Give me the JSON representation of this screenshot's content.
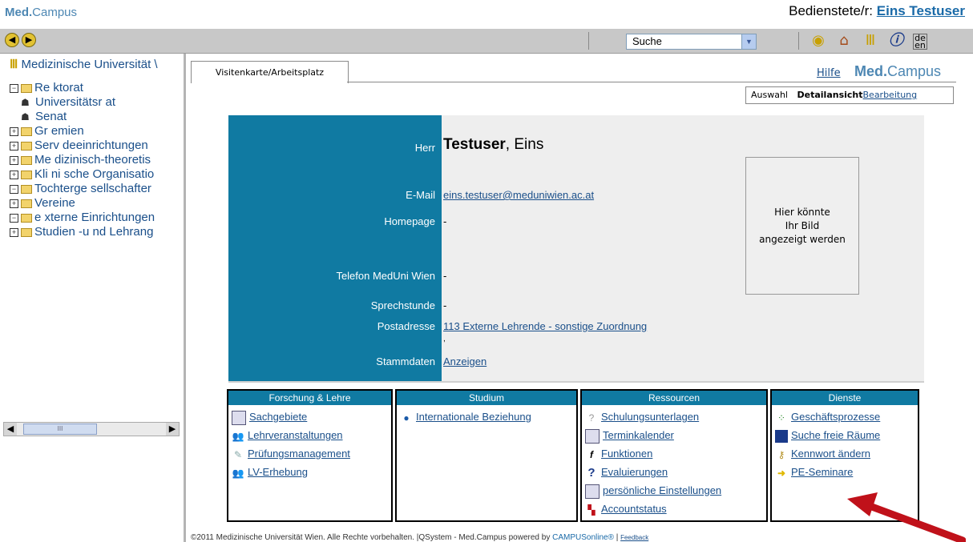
{
  "brand": {
    "med": "Med",
    "campus": "Campus",
    "dot": "."
  },
  "user": {
    "prefix": "Bedienstete/r:",
    "name": "Eins Testuser"
  },
  "toolbar": {
    "search_value": "Suche"
  },
  "leftnav": {
    "root": "Medizinische Universität \\",
    "items": [
      "Re ktorat",
      "Universitätsr at",
      "Senat",
      "Gr emien",
      "Serv deeinrichtungen",
      "Me dizinisch-theoretis",
      "Kli ni sche Organisatio",
      "Tochterge sellschafter",
      "Vereine",
      "e xterne Einrichtungen",
      "Studien -u nd Lehrang"
    ],
    "scroll_thumb": "III"
  },
  "tabs": {
    "active": "Visitenkarte/Arbeitsplatz"
  },
  "help": "Hilfe",
  "subnav": {
    "a": "Auswahl",
    "b": "Detailansicht",
    "c": "Bearbeitung"
  },
  "profile": {
    "salutation": "Herr",
    "lastname": "Testuser",
    "firstname": ", Eins",
    "email_label": "E-Mail",
    "email": "eins.testuser@meduniwien.ac.at",
    "homepage_label": "Homepage",
    "homepage": "-",
    "phone_label": "Telefon  MedUni Wien",
    "phone": "-",
    "office_label": "Sprechstunde",
    "office": "-",
    "address_label": "Postadresse",
    "address": "113 Externe Lehrende - sonstige Zuordnung",
    "comma": ",",
    "master_label": "Stammdaten",
    "master": "Anzeigen",
    "photo_l1": "Hier könnte",
    "photo_l2": "Ihr Bild",
    "photo_l3": "angezeigt werden"
  },
  "boxes": {
    "forschung": {
      "title": "Forschung & Lehre",
      "items": [
        "Sachgebiete",
        "Lehrveranstaltungen",
        "Prüfungsmanagement",
        "LV-Erhebung"
      ]
    },
    "studium": {
      "title": "Studium",
      "items": [
        "Internationale Beziehung"
      ]
    },
    "ressourcen": {
      "title": "Ressourcen",
      "items": [
        "Schulungsunterlagen",
        "Terminkalender",
        "Funktionen",
        "Evaluierungen",
        "persönliche Einstellungen",
        "Accountstatus"
      ]
    },
    "dienste": {
      "title": "Dienste",
      "items": [
        "Geschäftsprozesse",
        "Suche freie Räume",
        "Kennwort ändern",
        "PE-Seminare"
      ]
    }
  },
  "footer": {
    "text": "©2011 Medizinische Universität Wien. Alle Rechte vorbehalten. |QSystem - Med.Campus powered by ",
    "campusonline": "CAMPUSonline®",
    "sep": " | ",
    "feedback": "Feedback"
  },
  "colors": {
    "blue_panel": "#107aa2",
    "link": "#1a4f8a",
    "arrow": "#c0111a"
  }
}
